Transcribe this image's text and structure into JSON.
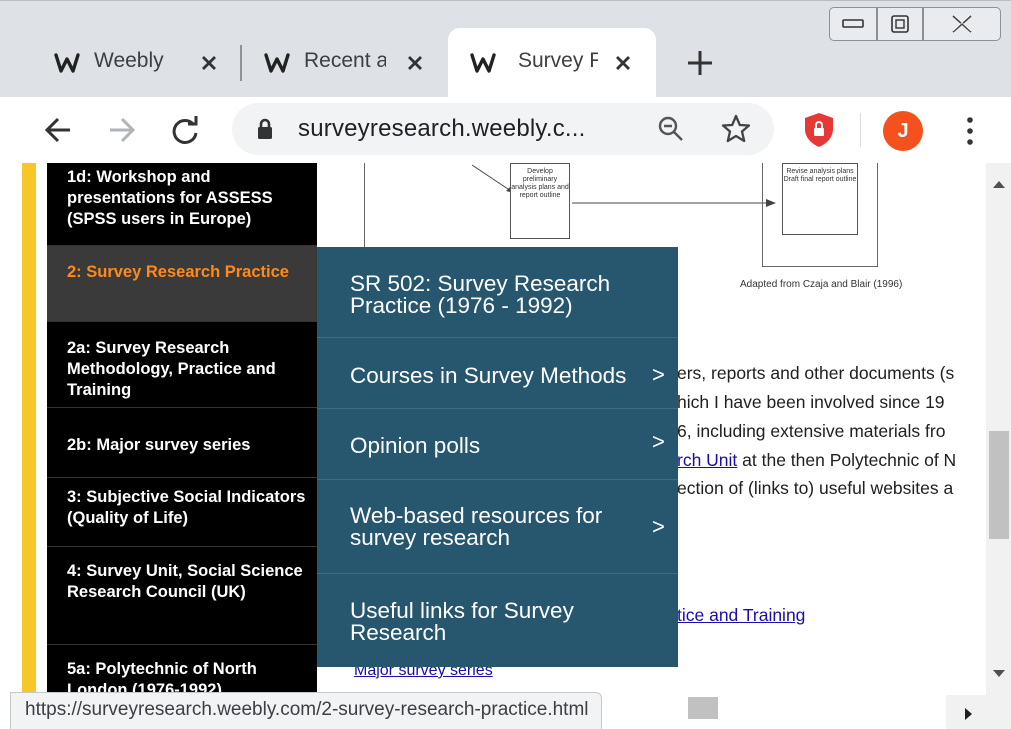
{
  "window": {
    "controls": [
      "minimize",
      "maximize",
      "close"
    ]
  },
  "tabs": [
    {
      "title": "Weebly",
      "icon": "weebly-icon",
      "active": false
    },
    {
      "title": "Recent a",
      "icon": "weebly-icon",
      "active": false
    },
    {
      "title": "Survey F",
      "icon": "weebly-icon",
      "active": true
    }
  ],
  "toolbar": {
    "url": "surveyresearch.weebly.c...",
    "avatar_letter": "J",
    "avatar_color": "#f4511e"
  },
  "sidenav": {
    "items": [
      {
        "label": "1d: Workshop and presentations for ASSESS (SPSS users in Europe)",
        "active": false
      },
      {
        "label": "2: Survey Research Practice",
        "active": true
      },
      {
        "label": "2a: Survey Research Methodology, Practice and Training",
        "active": false
      },
      {
        "label": "2b: Major survey series",
        "active": false
      },
      {
        "label": "3: Subjective Social Indicators (Quality of Life)",
        "active": false
      },
      {
        "label": "4: Survey Unit, Social Science Research Council (UK)",
        "active": false
      },
      {
        "label": "5a: Polytechnic of North London (1976-1992)",
        "active": false
      }
    ],
    "accent_color": "#ff8a1a"
  },
  "diagram": {
    "box1": "Develop preliminary analysis plans and report outline",
    "box2": "Revise analysis plans Draft final report outline",
    "caption": "Adapted from Czaja and Blair (1996)"
  },
  "content": {
    "line1": "ers, reports and other documents (s",
    "line2": "hich I have been involved since 19",
    "line3": "6, including extensive materials fro",
    "line4_link": "rch Unit",
    "line4_rest": " at the then Polytechnic of N",
    "line5": "ection of (links to) useful websites a",
    "link_training": "tice and Training",
    "link_major": "Major survey series"
  },
  "dropdown": {
    "items": [
      {
        "label": "SR 502: Survey Research Practice (1976 - 1992)",
        "has_submenu": false
      },
      {
        "label": "Courses in Survey Methods",
        "has_submenu": true
      },
      {
        "label": "Opinion polls",
        "has_submenu": true
      },
      {
        "label": "Web-based resources for survey research",
        "has_submenu": true
      },
      {
        "label": "Useful links for Survey Research",
        "has_submenu": false
      }
    ],
    "chevron": ">",
    "background": "#27566f"
  },
  "status": {
    "url": "https://surveyresearch.weebly.com/2-survey-research-practice.html"
  }
}
